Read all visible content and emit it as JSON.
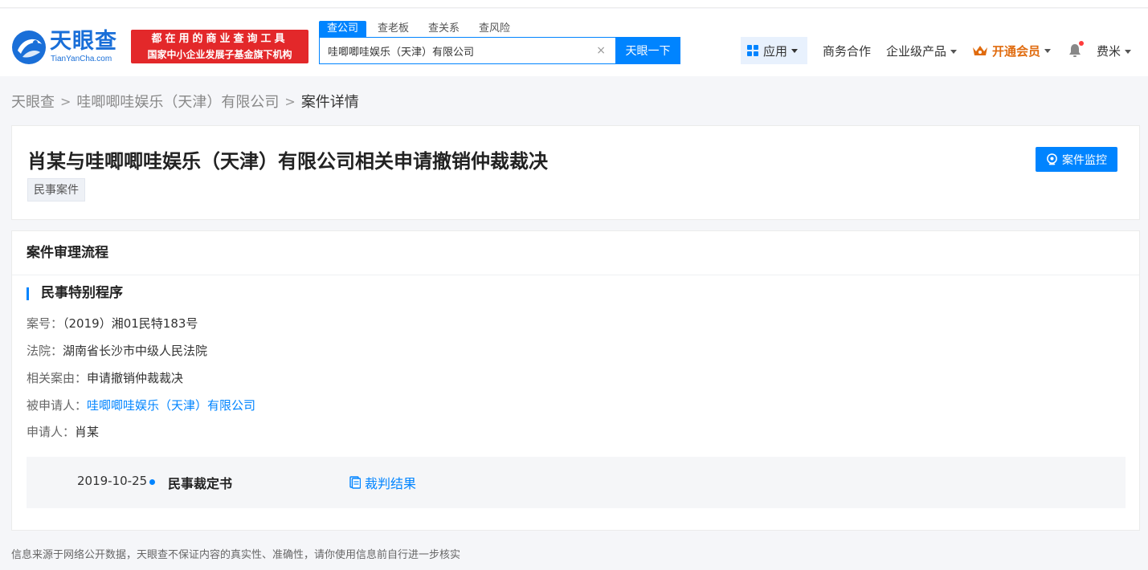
{
  "header": {
    "logo_text": "天眼查",
    "logo_sub": "TianYanCha.com",
    "slogan_line1": "都在用的商业查询工具",
    "slogan_line2": "国家中小企业发展子基金旗下机构",
    "search_tabs": [
      "查公司",
      "查老板",
      "查关系",
      "查风险"
    ],
    "search_value": "哇唧唧哇娱乐（天津）有限公司",
    "search_clear": "×",
    "search_button": "天眼一下",
    "nav": {
      "app": "应用",
      "business": "商务合作",
      "enterprise": "企业级产品",
      "vip": "开通会员",
      "user": "费米"
    }
  },
  "breadcrumb": {
    "home": "天眼查",
    "company": "哇唧唧哇娱乐（天津）有限公司",
    "current": "案件详情",
    "sep": ">"
  },
  "case": {
    "title": "肖某与哇唧唧哇娱乐（天津）有限公司相关申请撤销仲裁裁决",
    "tag": "民事案件",
    "monitor_button": "案件监控"
  },
  "process": {
    "section_title": "案件审理流程",
    "procedure_title": "民事特别程序",
    "fields": {
      "case_no_label": "案号：",
      "case_no_value": "（2019）湘01民特183号",
      "court_label": "法院：",
      "court_value": "湖南省长沙市中级人民法院",
      "cause_label": "相关案由：",
      "cause_value": "申请撤销仲裁裁决",
      "respondent_label": "被申请人：",
      "respondent_value": "哇唧唧哇娱乐（天津）有限公司",
      "applicant_label": "申请人：",
      "applicant_value": "肖某"
    },
    "timeline": {
      "date": "2019-10-25",
      "document": "民事裁定书",
      "result_link": "裁判结果"
    }
  },
  "footer": {
    "disclaimer": "信息来源于网络公开数据，天眼查不保证内容的真实性、准确性，请你使用信息前自行进一步核实"
  },
  "colors": {
    "brand_blue": "#0084ff",
    "slogan_red": "#e3282a",
    "vip_orange": "#e06b0e"
  }
}
